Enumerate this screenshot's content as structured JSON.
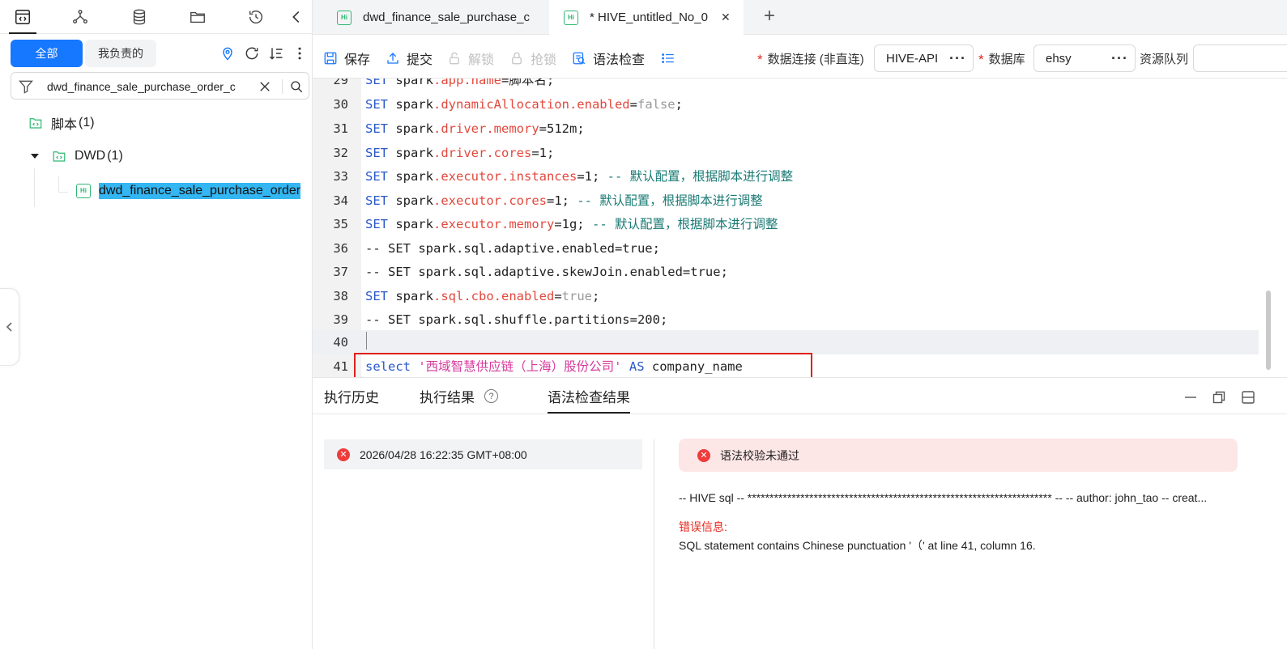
{
  "left_panel": {
    "scope_all": "全部",
    "scope_mine": "我负责的",
    "search_value": "dwd_finance_sale_purchase_order_c",
    "tree": {
      "root_label": "脚本",
      "root_count": "(1)",
      "folder_label": "DWD",
      "folder_count": "(1)",
      "file_label": "dwd_finance_sale_purchase_order"
    }
  },
  "tabs": [
    {
      "label": "dwd_finance_sale_purchase_c",
      "badge": "Hi"
    },
    {
      "label": "* HIVE_untitled_No_0",
      "badge": "Hi",
      "close": "✕"
    }
  ],
  "toolbar": {
    "save": "保存",
    "submit": "提交",
    "unlock": "解锁",
    "grab_lock": "抢锁",
    "syntax_check": "语法检查",
    "connection_label": "数据连接 (非直连)",
    "connection_value": "HIVE-API",
    "database_label": "数据库",
    "database_value": "ehsy",
    "queue_label": "资源队列",
    "required_mark": "*",
    "more": "···"
  },
  "editor": {
    "lines": [
      {
        "n": "29",
        "c": "SET spark.app.name=脚本名;"
      },
      {
        "n": "30",
        "c": "SET spark.dynamicAllocation.enabled=false;"
      },
      {
        "n": "31",
        "c": "SET spark.driver.memory=512m;"
      },
      {
        "n": "32",
        "c": "SET spark.driver.cores=1;"
      },
      {
        "n": "33",
        "c": "SET spark.executor.instances=1; -- 默认配置，根据脚本进行调整"
      },
      {
        "n": "34",
        "c": "SET spark.executor.cores=1; -- 默认配置，根据脚本进行调整"
      },
      {
        "n": "35",
        "c": "SET spark.executor.memory=1g; -- 默认配置，根据脚本进行调整"
      },
      {
        "n": "36",
        "c": "-- SET spark.sql.adaptive.enabled=true;"
      },
      {
        "n": "37",
        "c": "-- SET spark.sql.adaptive.skewJoin.enabled=true;"
      },
      {
        "n": "38",
        "c": "SET spark.sql.cbo.enabled=true;"
      },
      {
        "n": "39",
        "c": "-- SET spark.sql.shuffle.partitions=200;"
      },
      {
        "n": "40",
        "c": ""
      },
      {
        "n": "41",
        "c": "select '西域智慧供应链（上海）股份公司' AS company_name"
      }
    ]
  },
  "bottom_panel": {
    "tab_history": "执行历史",
    "tab_result": "执行结果",
    "tab_syntax": "语法检查结果",
    "help": "?",
    "history_time": "2026/04/28 16:22:35 GMT+08:00",
    "result_status": "语法校验未通过",
    "result_sql": "-- HIVE sql -- ********************************************************************* -- -- author: john_tao -- creat...",
    "error_label": "错误信息:",
    "error_message": "SQL statement contains Chinese punctuation '（' at line 41, column 16."
  },
  "colors": {
    "primary": "#1677ff",
    "keyword": "#2957c8",
    "property": "#e2483d",
    "comment": "#1a7a74",
    "string": "#d63a9c",
    "error": "#e5261c",
    "selected_file": "#33b6f2"
  }
}
